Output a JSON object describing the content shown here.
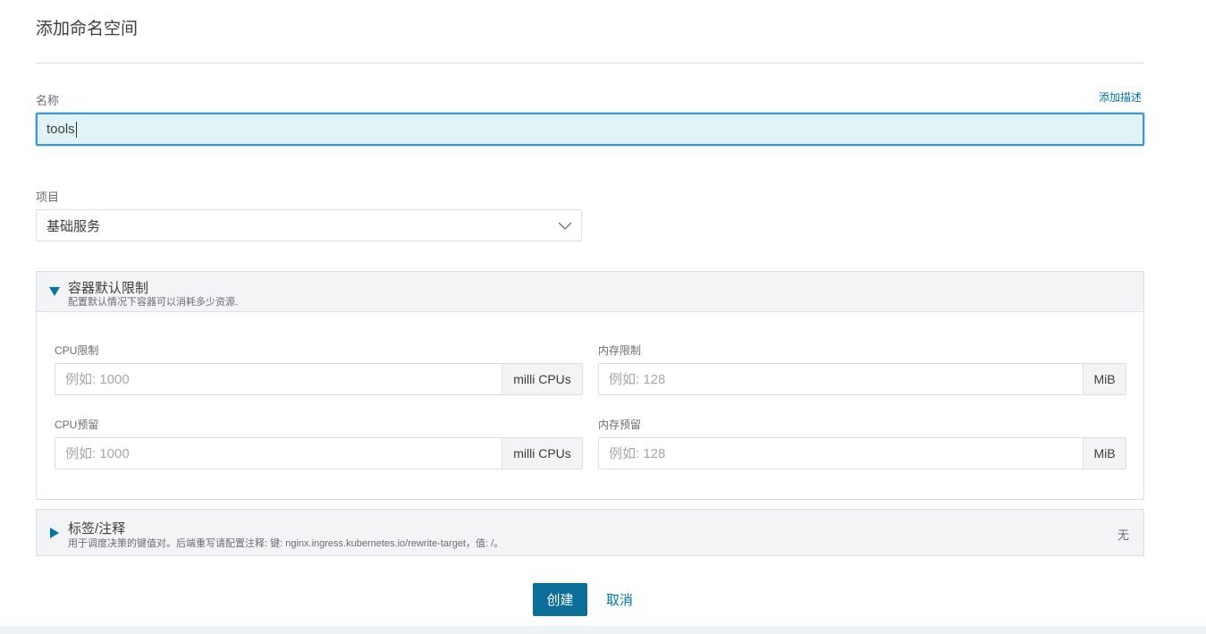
{
  "page": {
    "title": "添加命名空间"
  },
  "name_field": {
    "label": "名称",
    "value": "tools",
    "add_description_label": "添加描述"
  },
  "project_field": {
    "label": "项目",
    "selected": "基础服务"
  },
  "container_limits": {
    "title": "容器默认限制",
    "description": "配置默认情况下容器可以消耗多少资源.",
    "expanded": true,
    "cpu_limit": {
      "label": "CPU限制",
      "placeholder": "例如: 1000",
      "unit": "milli CPUs"
    },
    "memory_limit": {
      "label": "内存限制",
      "placeholder": "例如: 128",
      "unit": "MiB"
    },
    "cpu_reservation": {
      "label": "CPU预留",
      "placeholder": "例如: 1000",
      "unit": "milli CPUs"
    },
    "memory_reservation": {
      "label": "内存预留",
      "placeholder": "例如: 128",
      "unit": "MiB"
    }
  },
  "labels_annotations": {
    "title": "标签/注释",
    "description": "用于调度决策的键值对。后端重写请配置注释: 键: nginx.ingress.kubernetes.io/rewrite-target，值: /。",
    "value": "无",
    "expanded": false
  },
  "actions": {
    "create_label": "创建",
    "cancel_label": "取消"
  },
  "colors": {
    "accent": "#0075a8",
    "primary_button": "#0d6d99",
    "focus_border": "#3d98d3",
    "panel_header_bg": "#f2f4f5"
  }
}
